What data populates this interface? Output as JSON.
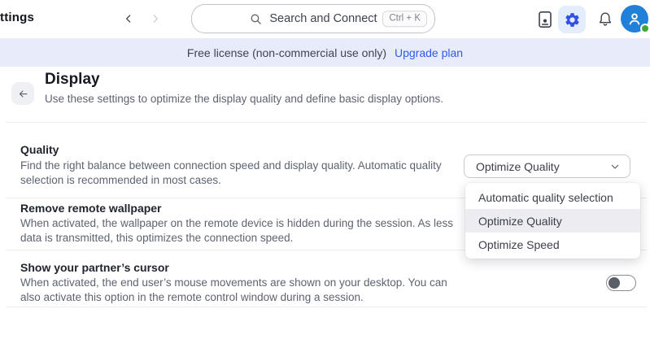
{
  "colors": {
    "accent-blue": "#2f5be8",
    "banner-bg": "#e8ebfa",
    "avatar-blue": "#2180d8",
    "presence-green": "#46a33c",
    "text-gray": "#5d6470",
    "border-gray": "#c6c9cf",
    "divider": "#ededef",
    "gear-btn-bg": "#e4edfb",
    "menu-highlight": "#ececf1"
  },
  "topbar": {
    "title": "ttings",
    "search_placeholder": "Search and Connect",
    "search_shortcut": "Ctrl + K",
    "icons": [
      "back-chevron-icon",
      "forward-chevron-icon",
      "search-icon",
      "contacts-device-icon",
      "settings-gear-icon",
      "notifications-bell-icon",
      "user-avatar-icon",
      "presence-dot"
    ]
  },
  "banner": {
    "message": "Free license (non-commercial use only)",
    "link_label": "Upgrade plan"
  },
  "page": {
    "title": "Display",
    "subtitle": "Use these settings to optimize the display quality and define basic display options.",
    "back_icon": "back-arrow-icon"
  },
  "rows": [
    {
      "title": "Quality",
      "description_lines": [
        "Find the right balance between connection speed and display quality. Automatic quality",
        "selection is recommended in most cases."
      ],
      "control": {
        "type": "dropdown",
        "value": "Optimize Quality"
      }
    },
    {
      "title": "Remove remote wallpaper",
      "description_lines": [
        "When activated, the wallpaper on the remote device is hidden during the session. As less",
        "data is transmitted, this optimizes the connection speed."
      ]
    },
    {
      "title": "Show your partner’s cursor",
      "description_lines": [
        "When activated, the end user’s mouse movements are shown on your desktop. You can",
        "also activate this option in the remote control window during a session."
      ],
      "control": {
        "type": "toggle",
        "state": "off"
      }
    }
  ],
  "quality_dropdown": {
    "open": true,
    "items": [
      {
        "label": "Automatic quality selection",
        "highlighted": false
      },
      {
        "label": "Optimize Quality",
        "highlighted": true
      },
      {
        "label": "Optimize Speed",
        "highlighted": false
      }
    ]
  }
}
